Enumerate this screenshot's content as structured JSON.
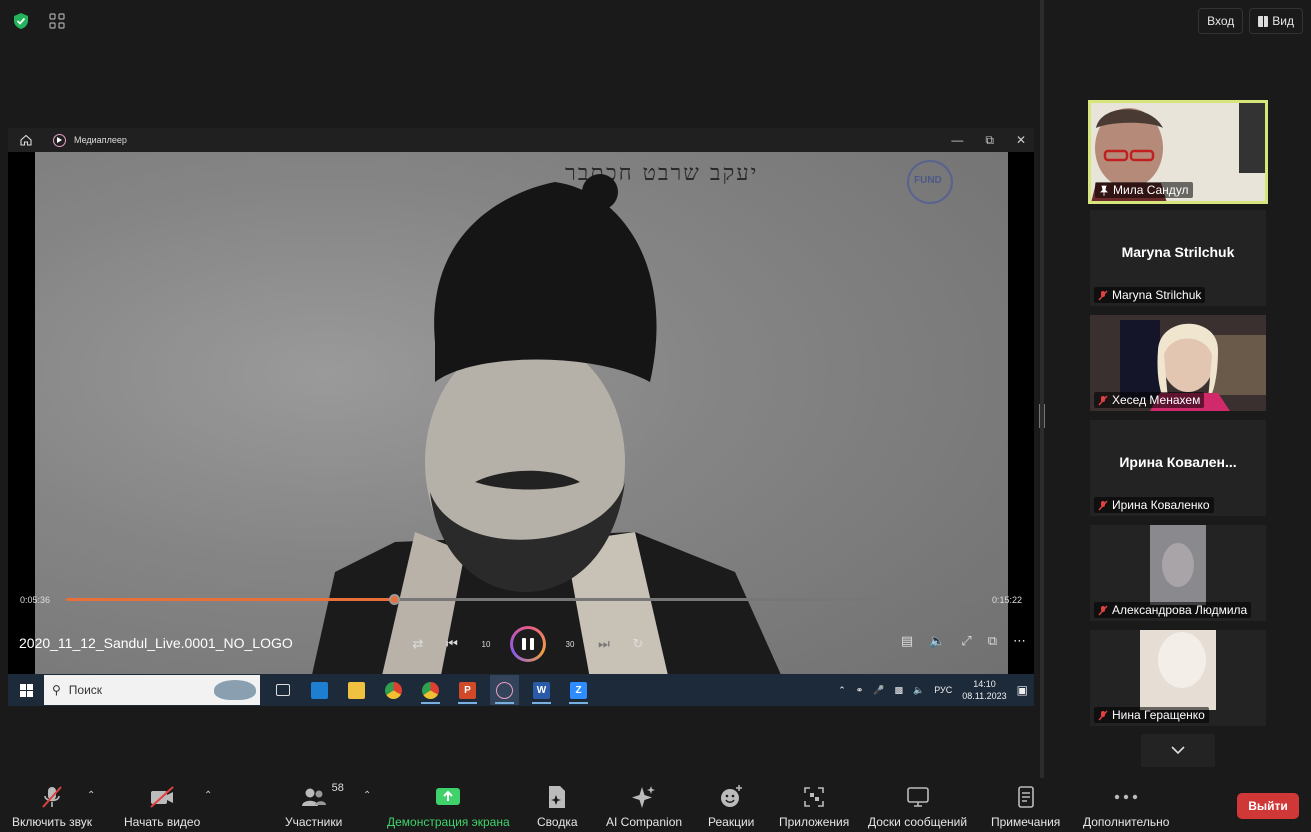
{
  "top_right": {
    "exit_label": "Вход",
    "view_label": "Вид"
  },
  "media_player": {
    "window_title": "Медиаплеер",
    "photo_caption": "יעקב שרבט חכתבר",
    "stamp_text": "FUND",
    "current_time": "0:05:36",
    "total_time": "0:15:22",
    "progress_fraction": 0.36,
    "filename": "2020_11_12_Sandul_Live.0001_NO_LOGO",
    "rewind_label": "10",
    "forward_label": "30"
  },
  "taskbar": {
    "search_placeholder": "Поиск",
    "language": "РУС",
    "time": "14:10",
    "date": "08.11.2023"
  },
  "participants": [
    {
      "name": "Мила Сандул",
      "active": true,
      "video": true
    },
    {
      "name": "Maryna Strilchuk",
      "big_name": "Maryna Strilchuk",
      "video": false
    },
    {
      "name": "Хесед Менахем",
      "video": true
    },
    {
      "name": "Ирина Коваленко",
      "big_name": "Ирина  Ковален...",
      "video": false
    },
    {
      "name": "Александрова Людмила",
      "video": true
    },
    {
      "name": "Нина Геращенко",
      "video": true
    }
  ],
  "toolbar": {
    "unmute_label": "Включить звук",
    "start_video_label": "Начать видео",
    "participants_label": "Участники",
    "participants_count": "58",
    "share_label": "Демонстрация экрана",
    "summary_label": "Сводка",
    "ai_label": "AI Companion",
    "reactions_label": "Реакции",
    "apps_label": "Приложения",
    "whiteboards_label": "Доски сообщений",
    "notes_label": "Примечания",
    "more_label": "Дополнительно",
    "end_label": "Выйти"
  },
  "colors": {
    "accent_green": "#3fd26b",
    "end_red": "#d03838",
    "active_speaker": "#d6e67a",
    "progress": "#e86e3a"
  }
}
